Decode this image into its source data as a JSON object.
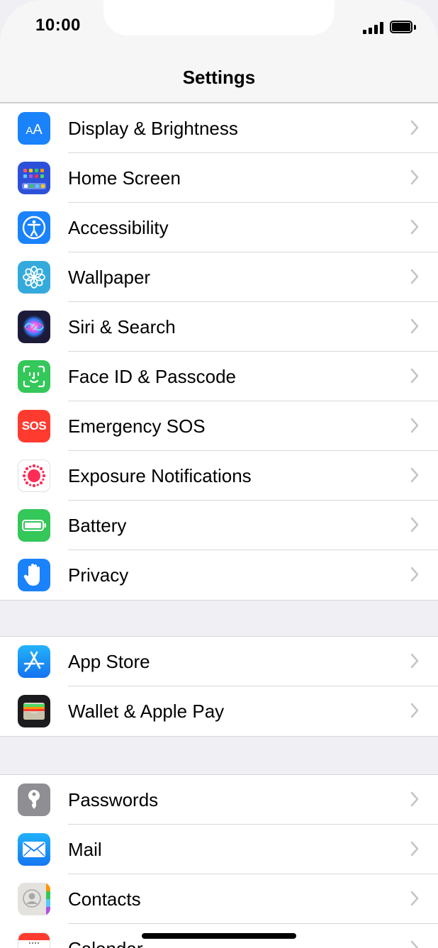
{
  "status_bar": {
    "time": "10:00"
  },
  "nav": {
    "title": "Settings"
  },
  "groups": [
    {
      "rows": [
        {
          "label": "Display & Brightness",
          "icon": "display-brightness-icon",
          "color": "#1a82fb"
        },
        {
          "label": "Home Screen",
          "icon": "home-screen-icon",
          "color": "#2c51d8"
        },
        {
          "label": "Accessibility",
          "icon": "accessibility-icon",
          "color": "#1a82fb"
        },
        {
          "label": "Wallpaper",
          "icon": "wallpaper-icon",
          "color": "#34aadc"
        },
        {
          "label": "Siri & Search",
          "icon": "siri-icon",
          "color": "#1c1c3a"
        },
        {
          "label": "Face ID & Passcode",
          "icon": "face-id-icon",
          "color": "#34c759"
        },
        {
          "label": "Emergency SOS",
          "icon": "sos-icon",
          "icon_text": "SOS",
          "color": "#ff3b30"
        },
        {
          "label": "Exposure Notifications",
          "icon": "exposure-icon",
          "color": "#ffffff"
        },
        {
          "label": "Battery",
          "icon": "battery-icon",
          "color": "#34c759"
        },
        {
          "label": "Privacy",
          "icon": "hand-icon",
          "color": "#1a82fb"
        }
      ]
    },
    {
      "rows": [
        {
          "label": "App Store",
          "icon": "app-store-icon",
          "color": "#1a82fb"
        },
        {
          "label": "Wallet & Apple Pay",
          "icon": "wallet-icon",
          "color": "#1c1c1e"
        }
      ]
    },
    {
      "rows": [
        {
          "label": "Passwords",
          "icon": "key-icon",
          "color": "#8e8e93"
        },
        {
          "label": "Mail",
          "icon": "mail-icon",
          "color": "#1a82fb"
        },
        {
          "label": "Contacts",
          "icon": "contacts-icon",
          "color": "#d9d9d9"
        },
        {
          "label": "Calendar",
          "icon": "calendar-icon",
          "color": "#ffffff"
        }
      ]
    }
  ]
}
